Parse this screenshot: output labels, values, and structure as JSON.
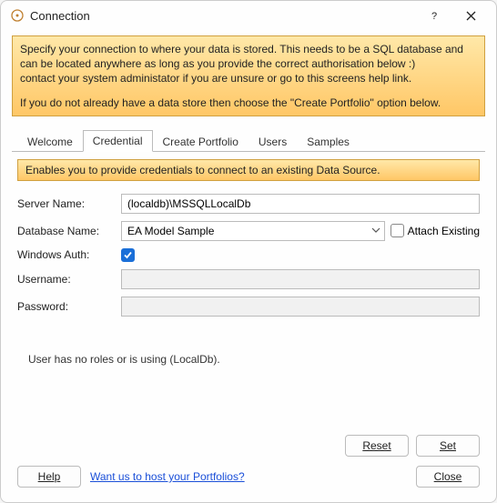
{
  "titlebar": {
    "title": "Connection"
  },
  "info": {
    "line1": "Specify your connection to where your data is stored. This needs to be a SQL database and can be located anywhere as long as you provide the correct authorisation below :)",
    "line2": "contact your system administator if you are unsure or go to this screens help link.",
    "line3": "If you do not already have a data store then choose the \"Create Portfolio\" option below."
  },
  "tabs": {
    "welcome": "Welcome",
    "credential": "Credential",
    "create_portfolio": "Create Portfolio",
    "users": "Users",
    "samples": "Samples"
  },
  "hint": "Enables you to provide credentials to connect to an existing Data Source.",
  "form": {
    "server_name_label": "Server Name:",
    "server_name_value": "(localdb)\\MSSQLLocalDb",
    "database_name_label": "Database Name:",
    "database_name_value": "EA Model Sample",
    "attach_existing_label": "Attach Existing",
    "windows_auth_label": "Windows Auth:",
    "windows_auth_checked": true,
    "username_label": "Username:",
    "username_value": "",
    "password_label": "Password:",
    "password_value": ""
  },
  "status": "User  has no roles or is using (LocalDb).",
  "buttons": {
    "reset": "Reset",
    "set": "Set",
    "help": "Help",
    "close": "Close"
  },
  "link": {
    "host_portfolios": "Want us to host your Portfolios?"
  }
}
